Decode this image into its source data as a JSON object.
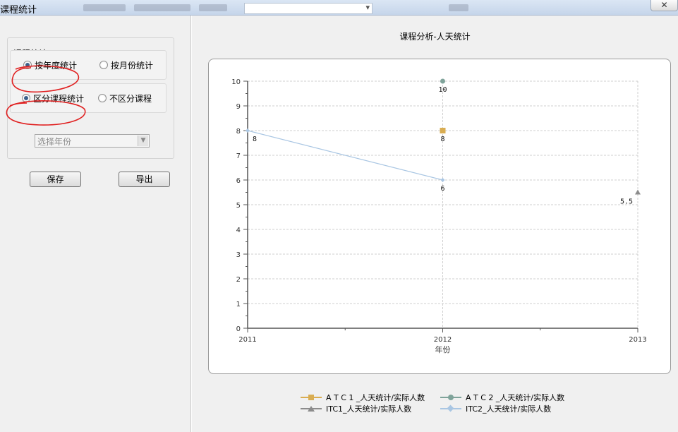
{
  "window": {
    "title": "课程统计",
    "close_label": "✕"
  },
  "left": {
    "group_label": "课程统计",
    "radio_yearly": "按年度统计",
    "radio_monthly": "按月份统计",
    "radio_by_course": "区分课程统计",
    "radio_no_course": "不区分课程",
    "select_year": "选择年份",
    "save_label": "保存",
    "export_label": "导出"
  },
  "chart_data": {
    "type": "line",
    "title": "课程分析-人天统计",
    "xlabel": "年份",
    "ylabel": "",
    "x": [
      2011,
      2012,
      2013
    ],
    "xlim": [
      2011,
      2013
    ],
    "ylim": [
      0,
      10
    ],
    "yticks": [
      0,
      1,
      2,
      3,
      4,
      5,
      6,
      7,
      8,
      9,
      10
    ],
    "grid": true,
    "legend_position": "bottom",
    "series": [
      {
        "name": "A T C 1 _人天统计/实际人数",
        "x": [
          2012
        ],
        "values": [
          8
        ],
        "color": "#d9ad52",
        "marker": "square",
        "labels": [
          "8"
        ]
      },
      {
        "name": "A T C 2 _人天统计/实际人数",
        "x": [
          2012
        ],
        "values": [
          10
        ],
        "color": "#7fa39a",
        "marker": "circle",
        "labels": [
          "10"
        ]
      },
      {
        "name": "ITC1_人天统计/实际人数",
        "x": [
          2013
        ],
        "values": [
          5.5
        ],
        "color": "#8c8c8c",
        "marker": "triangle",
        "labels": [
          "5.5"
        ]
      },
      {
        "name": "ITC2_人天统计/实际人数",
        "x": [
          2011,
          2012
        ],
        "values": [
          8,
          6
        ],
        "color": "#a9c6e3",
        "marker": "diamond",
        "labels": [
          "8",
          "6"
        ]
      }
    ]
  }
}
